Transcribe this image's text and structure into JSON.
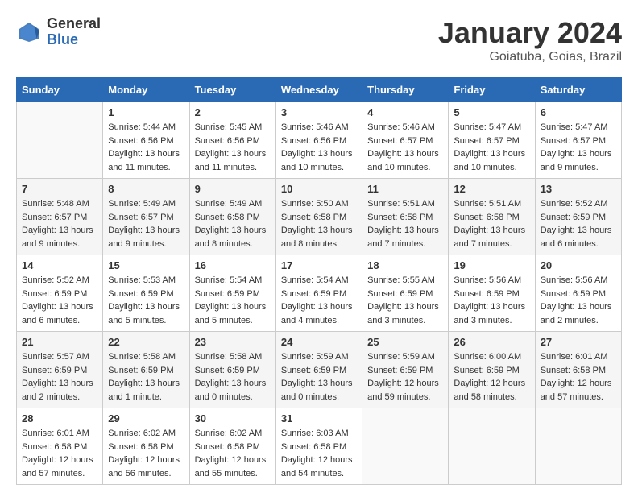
{
  "header": {
    "logo": {
      "general": "General",
      "blue": "Blue"
    },
    "title": "January 2024",
    "location": "Goiatuba, Goias, Brazil"
  },
  "days_of_week": [
    "Sunday",
    "Monday",
    "Tuesday",
    "Wednesday",
    "Thursday",
    "Friday",
    "Saturday"
  ],
  "weeks": [
    [
      {
        "day": "",
        "sunrise": "",
        "sunset": "",
        "daylight": ""
      },
      {
        "day": "1",
        "sunrise": "Sunrise: 5:44 AM",
        "sunset": "Sunset: 6:56 PM",
        "daylight": "Daylight: 13 hours and 11 minutes."
      },
      {
        "day": "2",
        "sunrise": "Sunrise: 5:45 AM",
        "sunset": "Sunset: 6:56 PM",
        "daylight": "Daylight: 13 hours and 11 minutes."
      },
      {
        "day": "3",
        "sunrise": "Sunrise: 5:46 AM",
        "sunset": "Sunset: 6:56 PM",
        "daylight": "Daylight: 13 hours and 10 minutes."
      },
      {
        "day": "4",
        "sunrise": "Sunrise: 5:46 AM",
        "sunset": "Sunset: 6:57 PM",
        "daylight": "Daylight: 13 hours and 10 minutes."
      },
      {
        "day": "5",
        "sunrise": "Sunrise: 5:47 AM",
        "sunset": "Sunset: 6:57 PM",
        "daylight": "Daylight: 13 hours and 10 minutes."
      },
      {
        "day": "6",
        "sunrise": "Sunrise: 5:47 AM",
        "sunset": "Sunset: 6:57 PM",
        "daylight": "Daylight: 13 hours and 9 minutes."
      }
    ],
    [
      {
        "day": "7",
        "sunrise": "Sunrise: 5:48 AM",
        "sunset": "Sunset: 6:57 PM",
        "daylight": "Daylight: 13 hours and 9 minutes."
      },
      {
        "day": "8",
        "sunrise": "Sunrise: 5:49 AM",
        "sunset": "Sunset: 6:57 PM",
        "daylight": "Daylight: 13 hours and 9 minutes."
      },
      {
        "day": "9",
        "sunrise": "Sunrise: 5:49 AM",
        "sunset": "Sunset: 6:58 PM",
        "daylight": "Daylight: 13 hours and 8 minutes."
      },
      {
        "day": "10",
        "sunrise": "Sunrise: 5:50 AM",
        "sunset": "Sunset: 6:58 PM",
        "daylight": "Daylight: 13 hours and 8 minutes."
      },
      {
        "day": "11",
        "sunrise": "Sunrise: 5:51 AM",
        "sunset": "Sunset: 6:58 PM",
        "daylight": "Daylight: 13 hours and 7 minutes."
      },
      {
        "day": "12",
        "sunrise": "Sunrise: 5:51 AM",
        "sunset": "Sunset: 6:58 PM",
        "daylight": "Daylight: 13 hours and 7 minutes."
      },
      {
        "day": "13",
        "sunrise": "Sunrise: 5:52 AM",
        "sunset": "Sunset: 6:59 PM",
        "daylight": "Daylight: 13 hours and 6 minutes."
      }
    ],
    [
      {
        "day": "14",
        "sunrise": "Sunrise: 5:52 AM",
        "sunset": "Sunset: 6:59 PM",
        "daylight": "Daylight: 13 hours and 6 minutes."
      },
      {
        "day": "15",
        "sunrise": "Sunrise: 5:53 AM",
        "sunset": "Sunset: 6:59 PM",
        "daylight": "Daylight: 13 hours and 5 minutes."
      },
      {
        "day": "16",
        "sunrise": "Sunrise: 5:54 AM",
        "sunset": "Sunset: 6:59 PM",
        "daylight": "Daylight: 13 hours and 5 minutes."
      },
      {
        "day": "17",
        "sunrise": "Sunrise: 5:54 AM",
        "sunset": "Sunset: 6:59 PM",
        "daylight": "Daylight: 13 hours and 4 minutes."
      },
      {
        "day": "18",
        "sunrise": "Sunrise: 5:55 AM",
        "sunset": "Sunset: 6:59 PM",
        "daylight": "Daylight: 13 hours and 3 minutes."
      },
      {
        "day": "19",
        "sunrise": "Sunrise: 5:56 AM",
        "sunset": "Sunset: 6:59 PM",
        "daylight": "Daylight: 13 hours and 3 minutes."
      },
      {
        "day": "20",
        "sunrise": "Sunrise: 5:56 AM",
        "sunset": "Sunset: 6:59 PM",
        "daylight": "Daylight: 13 hours and 2 minutes."
      }
    ],
    [
      {
        "day": "21",
        "sunrise": "Sunrise: 5:57 AM",
        "sunset": "Sunset: 6:59 PM",
        "daylight": "Daylight: 13 hours and 2 minutes."
      },
      {
        "day": "22",
        "sunrise": "Sunrise: 5:58 AM",
        "sunset": "Sunset: 6:59 PM",
        "daylight": "Daylight: 13 hours and 1 minute."
      },
      {
        "day": "23",
        "sunrise": "Sunrise: 5:58 AM",
        "sunset": "Sunset: 6:59 PM",
        "daylight": "Daylight: 13 hours and 0 minutes."
      },
      {
        "day": "24",
        "sunrise": "Sunrise: 5:59 AM",
        "sunset": "Sunset: 6:59 PM",
        "daylight": "Daylight: 13 hours and 0 minutes."
      },
      {
        "day": "25",
        "sunrise": "Sunrise: 5:59 AM",
        "sunset": "Sunset: 6:59 PM",
        "daylight": "Daylight: 12 hours and 59 minutes."
      },
      {
        "day": "26",
        "sunrise": "Sunrise: 6:00 AM",
        "sunset": "Sunset: 6:59 PM",
        "daylight": "Daylight: 12 hours and 58 minutes."
      },
      {
        "day": "27",
        "sunrise": "Sunrise: 6:01 AM",
        "sunset": "Sunset: 6:58 PM",
        "daylight": "Daylight: 12 hours and 57 minutes."
      }
    ],
    [
      {
        "day": "28",
        "sunrise": "Sunrise: 6:01 AM",
        "sunset": "Sunset: 6:58 PM",
        "daylight": "Daylight: 12 hours and 57 minutes."
      },
      {
        "day": "29",
        "sunrise": "Sunrise: 6:02 AM",
        "sunset": "Sunset: 6:58 PM",
        "daylight": "Daylight: 12 hours and 56 minutes."
      },
      {
        "day": "30",
        "sunrise": "Sunrise: 6:02 AM",
        "sunset": "Sunset: 6:58 PM",
        "daylight": "Daylight: 12 hours and 55 minutes."
      },
      {
        "day": "31",
        "sunrise": "Sunrise: 6:03 AM",
        "sunset": "Sunset: 6:58 PM",
        "daylight": "Daylight: 12 hours and 54 minutes."
      },
      {
        "day": "",
        "sunrise": "",
        "sunset": "",
        "daylight": ""
      },
      {
        "day": "",
        "sunrise": "",
        "sunset": "",
        "daylight": ""
      },
      {
        "day": "",
        "sunrise": "",
        "sunset": "",
        "daylight": ""
      }
    ]
  ]
}
